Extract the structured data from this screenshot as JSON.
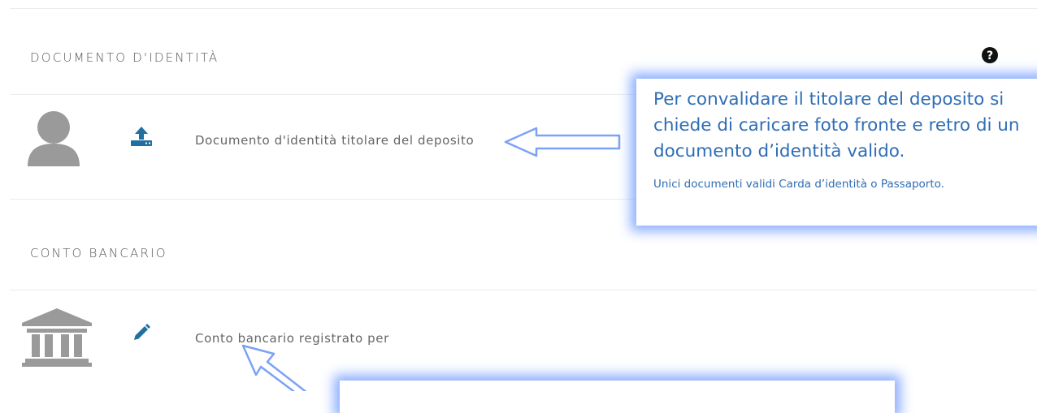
{
  "identity": {
    "title": "DOCUMENTO D'IDENTITÀ",
    "row_label": "Documento d'identità titolare del deposito"
  },
  "bank": {
    "title": "CONTO BANCARIO",
    "row_label": "Conto bancario registrato per"
  },
  "callout": {
    "main_text": "Per convalidare il titolare del deposito si chiede di caricare foto fronte e retro di un documento d’identità valido.",
    "note_text": "Unici documenti validi Carda d’identità o Passaporto."
  },
  "icons": {
    "help": "help-circle-icon",
    "user": "user-avatar-icon",
    "upload": "upload-icon",
    "bank": "bank-building-icon",
    "edit": "pencil-icon",
    "arrow": "arrow-icon"
  },
  "colors": {
    "accent": "#1f6fa0",
    "callout_text": "#2f6db5",
    "callout_glow": "#78a0ff",
    "icon_grey": "#9a9a9a"
  }
}
